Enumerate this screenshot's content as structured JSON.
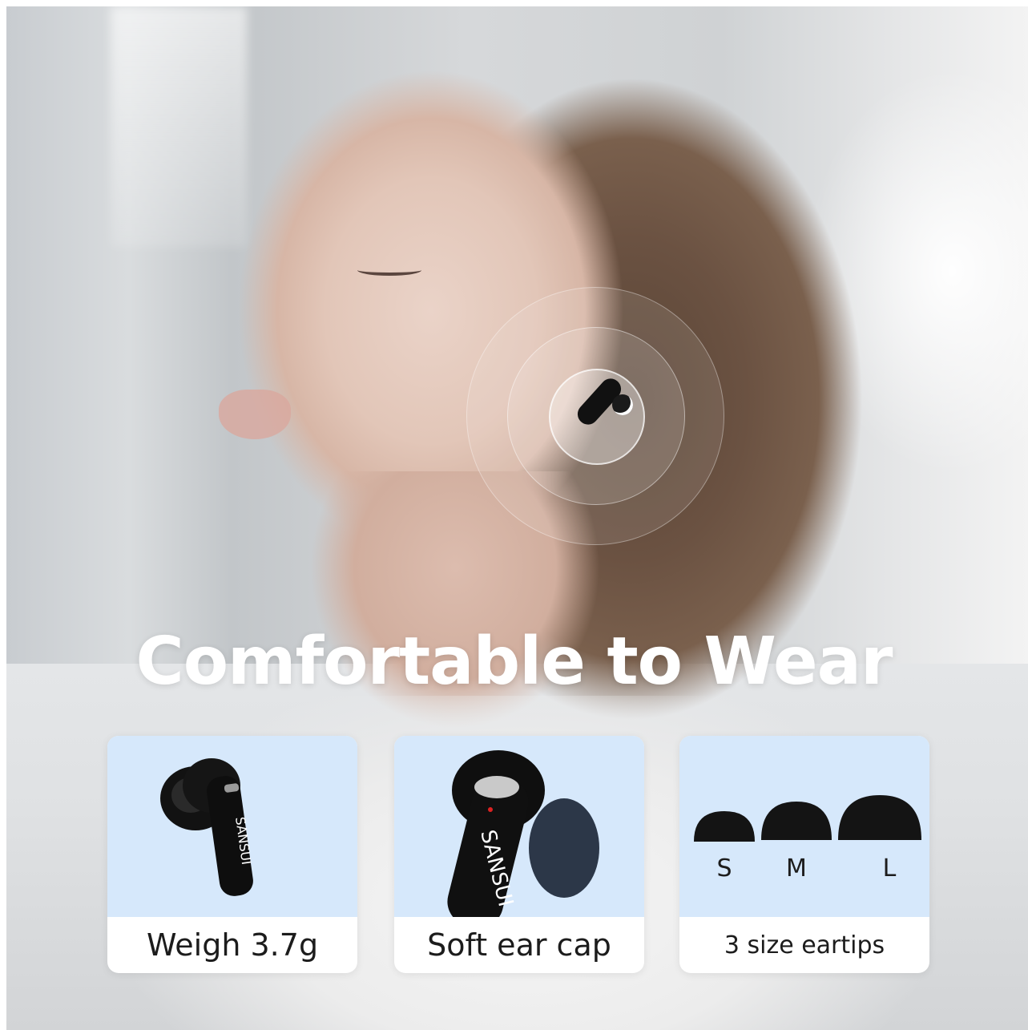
{
  "headline": "Comfortable to Wear",
  "brand": "SANSUI",
  "features": [
    {
      "caption": "Weigh 3.7g",
      "icon": "earbud-icon"
    },
    {
      "caption": "Soft ear cap",
      "icon": "earbud-closeup-icon"
    },
    {
      "caption": "3 size eartips",
      "icon": "eartips-icon"
    }
  ],
  "eartip_sizes": [
    "S",
    "M",
    "L"
  ],
  "colors": {
    "card_bg": "#d6e8fb",
    "earbud": "#111111",
    "text": "#1c1c1c",
    "headline": "#ffffff"
  }
}
